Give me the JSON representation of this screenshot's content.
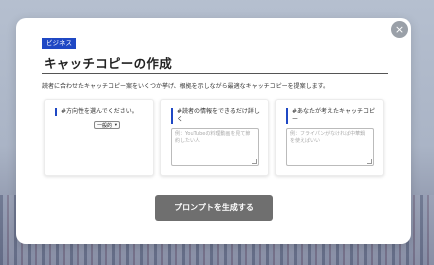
{
  "modal": {
    "badge": "ビジネス",
    "title": "キャッチコピーの作成",
    "description": "読者に合わせたキャッチコピー案をいくつか挙げ、根拠を示しながら最適なキャッチコピーを提案します。",
    "close_icon": "×"
  },
  "cards": [
    {
      "label": "#方向性を選んでください。",
      "select_value": "一般的",
      "select_chevron": "▾"
    },
    {
      "label": "#読者の情報をできるだけ詳しく",
      "placeholder": "例：YouTubeの料理動画を見て節約したい人"
    },
    {
      "label": "#あなたが考えたキャッチコピー",
      "placeholder": "例：フライパンがなければ中華鍋を使えばいい"
    }
  ],
  "generate_button": "プロンプトを生成する",
  "colors": {
    "accent": "#1f48c4",
    "button": "#6f6f6f"
  }
}
